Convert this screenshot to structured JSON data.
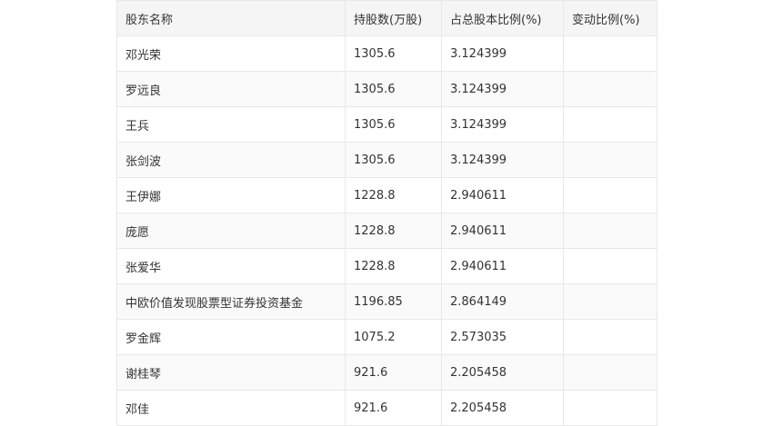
{
  "table": {
    "headers": [
      "股东名称",
      "持股数(万股)",
      "占总股本比例(%)",
      "变动比例(%)"
    ],
    "rows": [
      [
        "邓光荣",
        "1305.6",
        "3.124399",
        ""
      ],
      [
        "罗远良",
        "1305.6",
        "3.124399",
        ""
      ],
      [
        "王兵",
        "1305.6",
        "3.124399",
        ""
      ],
      [
        "张剑波",
        "1305.6",
        "3.124399",
        ""
      ],
      [
        "王伊娜",
        "1228.8",
        "2.940611",
        ""
      ],
      [
        "庞愿",
        "1228.8",
        "2.940611",
        ""
      ],
      [
        "张爱华",
        "1228.8",
        "2.940611",
        ""
      ],
      [
        "中欧价值发现股票型证券投资基金",
        "1196.85",
        "2.864149",
        ""
      ],
      [
        "罗金辉",
        "1075.2",
        "2.573035",
        ""
      ],
      [
        "谢桂琴",
        "921.6",
        "2.205458",
        ""
      ],
      [
        "邓佳",
        "921.6",
        "2.205458",
        ""
      ]
    ]
  }
}
